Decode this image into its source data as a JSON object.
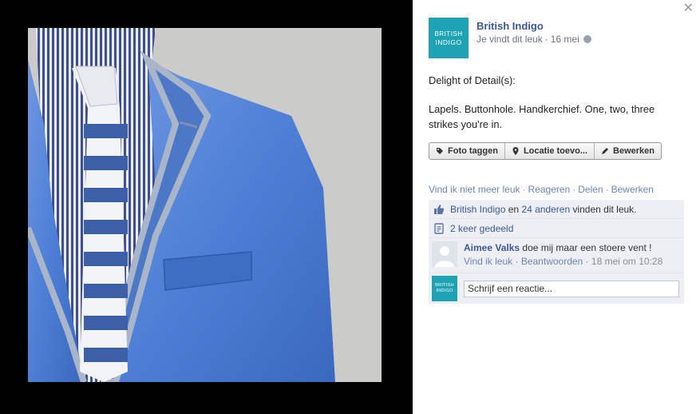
{
  "photo": {
    "alt": ""
  },
  "post": {
    "page_name": "British Indigo",
    "page_logo": {
      "line1": "BRITISH",
      "line2": "INDIGO"
    },
    "meta_like": "Je vindt dit leuk",
    "meta_sep": "·",
    "meta_date": "16 mei",
    "text_line1": "Delight of Detail(s):",
    "text_line2": "Lapels. Buttonhole. Handkerchief. One, two, three",
    "text_line3": "strikes you're in."
  },
  "buttons": {
    "tag": "Foto taggen",
    "location": "Locatie toevo...",
    "edit": "Bewerken"
  },
  "actions": {
    "unlike": "Vind ik niet meer leuk",
    "comment": "Reageren",
    "share": "Delen",
    "edit": "Bewerken",
    "sep": "·"
  },
  "likes": {
    "page": "British Indigo",
    "and": " en ",
    "others": "24 anderen",
    "suffix": " vinden dit leuk."
  },
  "shares": {
    "label": "2 keer gedeeld"
  },
  "comment": {
    "author": "Aimee Valks",
    "text": " doe mij maar een stoere vent !",
    "like": "Vind ik leuk",
    "reply": "Beantwoorden",
    "sep": " · ",
    "time": "18 mei om 10:28"
  },
  "reply": {
    "placeholder": "Schrijf een reactie..."
  },
  "colors": {
    "brand_teal": "#1ea3b4",
    "fb_blue": "#3b5998",
    "ufi_bg": "#edeff4"
  }
}
